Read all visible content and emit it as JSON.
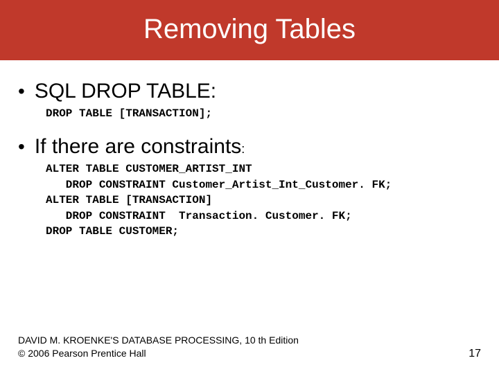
{
  "title": "Removing Tables",
  "bullet1": "SQL DROP TABLE:",
  "code1": "DROP TABLE [TRANSACTION];",
  "bullet2_main": "If there are constraints",
  "bullet2_colon": ":",
  "code2": "ALTER TABLE CUSTOMER_ARTIST_INT\n   DROP CONSTRAINT Customer_Artist_Int_Customer. FK;\nALTER TABLE [TRANSACTION]\n   DROP CONSTRAINT  Transaction. Customer. FK;\nDROP TABLE CUSTOMER;",
  "footer_line1": "DAVID M. KROENKE'S DATABASE PROCESSING, 10 th Edition",
  "footer_line2": "© 2006 Pearson Prentice Hall",
  "page_number": "17"
}
